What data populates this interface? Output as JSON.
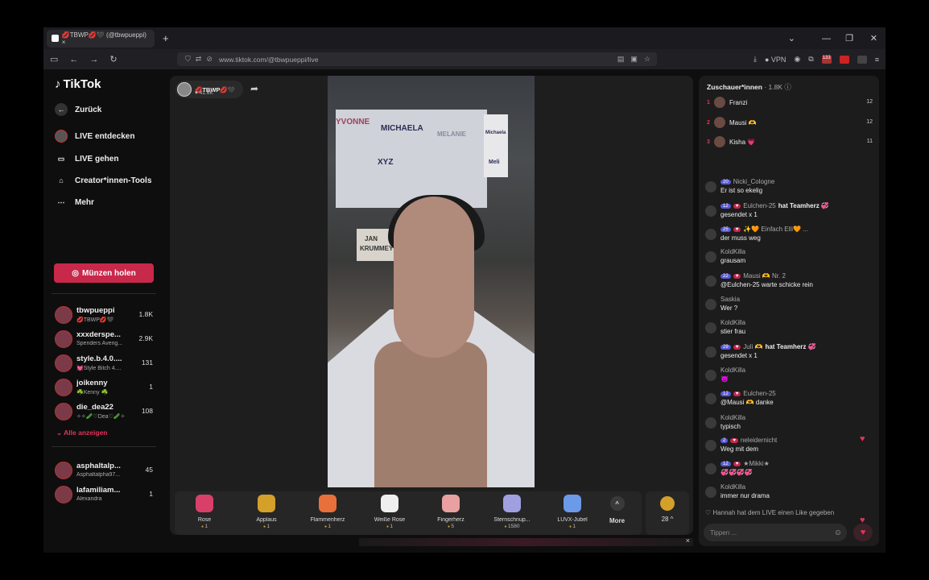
{
  "browser": {
    "tab_title": "💋TBWP💋🖤 (@tbwpueppi) ×",
    "tab_close": "×",
    "newtab": "+",
    "url": "www.tiktok.com/@tbwpueppi/live",
    "vpn": "VPN",
    "ext_badge": "133"
  },
  "sidebar": {
    "logo": "TikTok",
    "back": "Zurück",
    "nav": [
      {
        "label": "LIVE entdecken"
      },
      {
        "label": "LIVE gehen"
      },
      {
        "label": "Creator*innen-Tools"
      },
      {
        "label": "Mehr"
      }
    ],
    "coins_button": "Münzen holen",
    "accounts": [
      {
        "name": "tbwpueppi",
        "sub": "💋TBWP💋🖤",
        "count": "1.8K"
      },
      {
        "name": "xxxderspe...",
        "sub": "Spenders Aveng...",
        "count": "2.9K"
      },
      {
        "name": "style.b.4.0....",
        "sub": "💓Style Bitch 4....",
        "count": "131"
      },
      {
        "name": "joikenny",
        "sub": "☘️Kenny ☘️",
        "count": "1"
      },
      {
        "name": "die_dea22",
        "sub": "✧✧🥒♡Dea♡🥒✧",
        "count": "108"
      }
    ],
    "show_all": "Alle anzeigen",
    "following": [
      {
        "name": "asphaltalp...",
        "sub": "Asphaltalpha97...",
        "count": "45"
      },
      {
        "name": "lafamiliam...",
        "sub": "Alexandra",
        "count": "1"
      }
    ]
  },
  "stream": {
    "streamer_name": "💋TBWP💋🖤",
    "likes": "41.6K",
    "whiteboard": [
      "YVONNE",
      "MICHAELA",
      "MELANIE",
      "XYZ",
      "JAN",
      "KRUMMEY",
      "Michaela",
      "Meli"
    ],
    "gifts": [
      {
        "name": "Rose",
        "price": "1",
        "color": "#d8406a"
      },
      {
        "name": "Applaus",
        "price": "1",
        "color": "#d4a02a"
      },
      {
        "name": "Flammenherz",
        "price": "1",
        "color": "#e8703a"
      },
      {
        "name": "Weiße Rose",
        "price": "1",
        "color": "#eeeeee"
      },
      {
        "name": "Fingerherz",
        "price": "5",
        "color": "#e8a0a0"
      },
      {
        "name": "Sternschnup...",
        "price": "1580",
        "color": "#a0a0e0"
      },
      {
        "name": "LUVX-Jubel",
        "price": "1",
        "color": "#6a9ae8"
      }
    ],
    "more": "More",
    "coins_count": "28 ^",
    "strip_close": "×"
  },
  "chat": {
    "viewers_label": "Zuschauer*innen",
    "viewers_count": "· 1.8K",
    "top": [
      {
        "rank": "1",
        "name": "Franzi",
        "score": "12"
      },
      {
        "rank": "2",
        "name": "Mausi 🫶",
        "score": "12"
      },
      {
        "rank": "3",
        "name": "Kisha 💗",
        "score": "11"
      }
    ],
    "messages": [
      {
        "level": "20",
        "fan": "",
        "user": "Nicki_Cologne",
        "action": "",
        "text": "Er ist so ekelig"
      },
      {
        "level": "12",
        "fan": "♥",
        "user": "Eulchen-25",
        "action": "hat Teamherz 💞",
        "text": "gesendet x 1"
      },
      {
        "level": "25",
        "fan": "♥",
        "user": "✨🧡 Einfach Elli🧡 ...",
        "action": "",
        "text": "der muss weg"
      },
      {
        "level": "",
        "fan": "",
        "user": "KoldKilla",
        "action": "",
        "text": "grausam"
      },
      {
        "level": "22",
        "fan": "♥",
        "user": "Mausi 🫶  Nr. 2",
        "action": "",
        "text": "@Eulchen-25 warte schicke rein"
      },
      {
        "level": "",
        "fan": "",
        "user": "Saskia",
        "action": "",
        "text": "Wer ?"
      },
      {
        "level": "",
        "fan": "",
        "user": "KoldKilla",
        "action": "",
        "text": "stier frau"
      },
      {
        "level": "29",
        "fan": "♥",
        "user": "Juli 🫶",
        "action": "hat Teamherz 💞",
        "text": "gesendet x 1"
      },
      {
        "level": "",
        "fan": "",
        "user": "KoldKilla",
        "action": "",
        "text": "😈"
      },
      {
        "level": "12",
        "fan": "♥",
        "user": "Eulchen-25",
        "action": "",
        "text": "@Mausi 🫶 danke"
      },
      {
        "level": "",
        "fan": "",
        "user": "KoldKilla",
        "action": "",
        "text": "typisch"
      },
      {
        "level": "2",
        "fan": "♥",
        "user": "neleidernicht",
        "action": "",
        "text": "Weg mit dem"
      },
      {
        "level": "12",
        "fan": "♥",
        "user": "★Mikki★",
        "action": "",
        "text": "💞💞💞💞"
      },
      {
        "level": "",
        "fan": "",
        "user": "KoldKilla",
        "action": "",
        "text": "immer nur drama"
      }
    ],
    "like_notice": "Hannah hat dem LIVE einen Like gegeben",
    "input_placeholder": "Tippen ..."
  }
}
